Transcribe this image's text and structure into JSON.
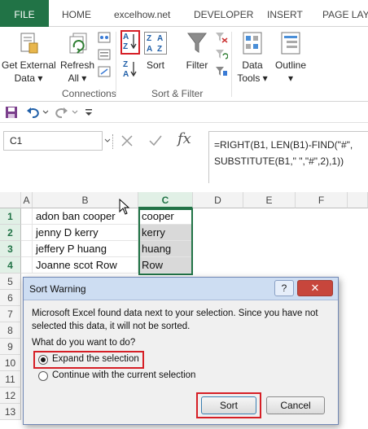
{
  "ribbon": {
    "tabs": [
      "FILE",
      "HOME",
      "excelhow.net",
      "DEVELOPER",
      "INSERT",
      "PAGE LAYO"
    ],
    "get_external_data": [
      "Get External",
      "Data ▾"
    ],
    "refresh_all": [
      "Refresh",
      "All ▾"
    ],
    "connections_group": "Connections",
    "sort": "Sort",
    "filter": "Filter",
    "sort_filter_group": "Sort & Filter",
    "data_tools": [
      "Data",
      "Tools ▾"
    ],
    "outline": [
      "Outline",
      "▾"
    ],
    "sort_az_top": "A",
    "sort_az_bottom": "Z",
    "sort_za_top": "Z",
    "sort_za_bottom": "A",
    "sort_icon_letters": [
      "Z",
      "A",
      "A",
      "Z"
    ]
  },
  "formula_bar": {
    "name_box": "C1",
    "fx": "fx",
    "formula_line1": "=RIGHT(B1, LEN(B1)-FIND(\"#\",",
    "formula_line2": "SUBSTITUTE(B1,\" \",\"#\",2),1))"
  },
  "sheet": {
    "columns": [
      "A",
      "B",
      "C",
      "D",
      "E",
      "F"
    ],
    "row_numbers": [
      "1",
      "2",
      "3",
      "4",
      "5",
      "6",
      "7",
      "8",
      "9",
      "10",
      "11",
      "12",
      "13"
    ],
    "rows": [
      {
        "b": "adon ban cooper",
        "c": "cooper"
      },
      {
        "b": "jenny D kerry",
        "c": "kerry"
      },
      {
        "b": "jeffery P huang",
        "c": "huang"
      },
      {
        "b": "Joanne scot Row",
        "c": "Row"
      }
    ]
  },
  "dialog": {
    "title": "Sort Warning",
    "help": "?",
    "close": "✕",
    "message": "Microsoft Excel found data next to your selection.  Since you have not selected this data, it will not be sorted.",
    "question": "What do you want to do?",
    "option_expand": "Expand the selection",
    "option_continue": "Continue with the current selection",
    "selected_option": "expand",
    "sort_button": "Sort",
    "cancel_button": "Cancel"
  },
  "colors": {
    "excel_green": "#217346",
    "highlight_red": "#d61f26",
    "dialog_title_blue": "#cdddf2",
    "close_red": "#c7463c"
  }
}
